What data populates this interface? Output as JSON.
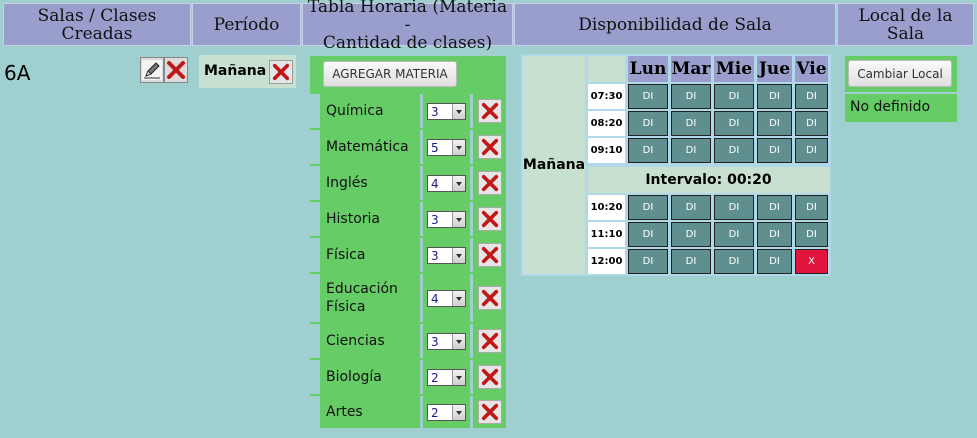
{
  "headers": {
    "rooms": "Salas / Clases Creadas",
    "period": "Período",
    "schedule_line1": "Tabla Horaria (Materia -",
    "schedule_line2": "Cantidad de clases)",
    "availability": "Disponibilidad de Sala",
    "local": "Local de la Sala"
  },
  "room": {
    "name": "6A",
    "edit_icon": "pencil-icon",
    "delete_icon": "close-icon"
  },
  "period": {
    "label": "Mañana",
    "delete_icon": "close-icon"
  },
  "schedule": {
    "add_button": "AGREGAR MATERIA",
    "subjects": [
      {
        "name": "Química",
        "count": "3"
      },
      {
        "name": "Matemática",
        "count": "5"
      },
      {
        "name": "Inglés",
        "count": "4"
      },
      {
        "name": "Historia",
        "count": "3"
      },
      {
        "name": "Física",
        "count": "3"
      },
      {
        "name": "Educación Física",
        "count": "4"
      },
      {
        "name": "Ciencias",
        "count": "3"
      },
      {
        "name": "Biología",
        "count": "2"
      },
      {
        "name": "Artes",
        "count": "2"
      }
    ]
  },
  "availability": {
    "shift": "Mañana",
    "days": [
      "Lun",
      "Mar",
      "Mie",
      "Jue",
      "Vie"
    ],
    "interval_label": "Intervalo: 00:20",
    "available_color": "#5f8f8f",
    "occupied_color": "#e0143c",
    "slots": [
      {
        "time": "07:30",
        "cells": [
          "DI",
          "DI",
          "DI",
          "DI",
          "DI"
        ]
      },
      {
        "time": "08:20",
        "cells": [
          "DI",
          "DI",
          "DI",
          "DI",
          "DI"
        ]
      },
      {
        "time": "09:10",
        "cells": [
          "DI",
          "DI",
          "DI",
          "DI",
          "DI"
        ]
      },
      {
        "time": "10:20",
        "cells": [
          "DI",
          "DI",
          "DI",
          "DI",
          "DI"
        ]
      },
      {
        "time": "11:10",
        "cells": [
          "DI",
          "DI",
          "DI",
          "DI",
          "DI"
        ]
      },
      {
        "time": "12:00",
        "cells": [
          "DI",
          "DI",
          "DI",
          "DI",
          "X"
        ]
      }
    ]
  },
  "local": {
    "button": "Cambiar Local",
    "value": "No definido"
  }
}
